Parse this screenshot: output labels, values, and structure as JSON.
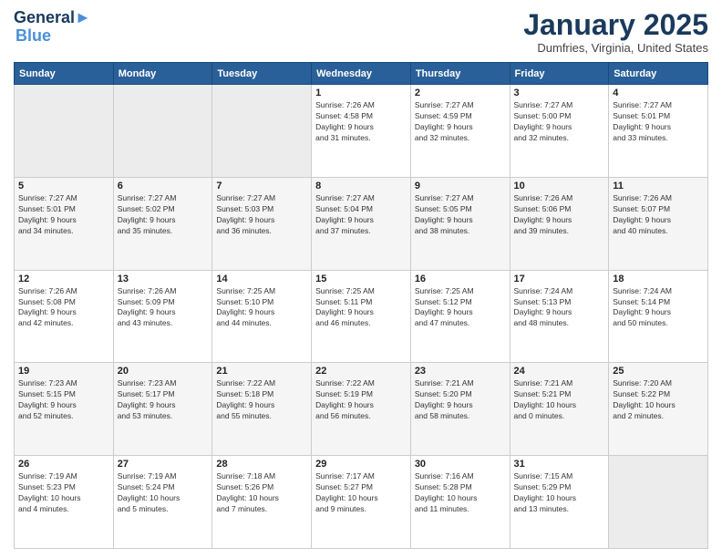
{
  "header": {
    "logo_line1": "General",
    "logo_line2": "Blue",
    "month_title": "January 2025",
    "location": "Dumfries, Virginia, United States"
  },
  "days_of_week": [
    "Sunday",
    "Monday",
    "Tuesday",
    "Wednesday",
    "Thursday",
    "Friday",
    "Saturday"
  ],
  "weeks": [
    [
      {
        "day": "",
        "info": ""
      },
      {
        "day": "",
        "info": ""
      },
      {
        "day": "",
        "info": ""
      },
      {
        "day": "1",
        "info": "Sunrise: 7:26 AM\nSunset: 4:58 PM\nDaylight: 9 hours\nand 31 minutes."
      },
      {
        "day": "2",
        "info": "Sunrise: 7:27 AM\nSunset: 4:59 PM\nDaylight: 9 hours\nand 32 minutes."
      },
      {
        "day": "3",
        "info": "Sunrise: 7:27 AM\nSunset: 5:00 PM\nDaylight: 9 hours\nand 32 minutes."
      },
      {
        "day": "4",
        "info": "Sunrise: 7:27 AM\nSunset: 5:01 PM\nDaylight: 9 hours\nand 33 minutes."
      }
    ],
    [
      {
        "day": "5",
        "info": "Sunrise: 7:27 AM\nSunset: 5:01 PM\nDaylight: 9 hours\nand 34 minutes."
      },
      {
        "day": "6",
        "info": "Sunrise: 7:27 AM\nSunset: 5:02 PM\nDaylight: 9 hours\nand 35 minutes."
      },
      {
        "day": "7",
        "info": "Sunrise: 7:27 AM\nSunset: 5:03 PM\nDaylight: 9 hours\nand 36 minutes."
      },
      {
        "day": "8",
        "info": "Sunrise: 7:27 AM\nSunset: 5:04 PM\nDaylight: 9 hours\nand 37 minutes."
      },
      {
        "day": "9",
        "info": "Sunrise: 7:27 AM\nSunset: 5:05 PM\nDaylight: 9 hours\nand 38 minutes."
      },
      {
        "day": "10",
        "info": "Sunrise: 7:26 AM\nSunset: 5:06 PM\nDaylight: 9 hours\nand 39 minutes."
      },
      {
        "day": "11",
        "info": "Sunrise: 7:26 AM\nSunset: 5:07 PM\nDaylight: 9 hours\nand 40 minutes."
      }
    ],
    [
      {
        "day": "12",
        "info": "Sunrise: 7:26 AM\nSunset: 5:08 PM\nDaylight: 9 hours\nand 42 minutes."
      },
      {
        "day": "13",
        "info": "Sunrise: 7:26 AM\nSunset: 5:09 PM\nDaylight: 9 hours\nand 43 minutes."
      },
      {
        "day": "14",
        "info": "Sunrise: 7:25 AM\nSunset: 5:10 PM\nDaylight: 9 hours\nand 44 minutes."
      },
      {
        "day": "15",
        "info": "Sunrise: 7:25 AM\nSunset: 5:11 PM\nDaylight: 9 hours\nand 46 minutes."
      },
      {
        "day": "16",
        "info": "Sunrise: 7:25 AM\nSunset: 5:12 PM\nDaylight: 9 hours\nand 47 minutes."
      },
      {
        "day": "17",
        "info": "Sunrise: 7:24 AM\nSunset: 5:13 PM\nDaylight: 9 hours\nand 48 minutes."
      },
      {
        "day": "18",
        "info": "Sunrise: 7:24 AM\nSunset: 5:14 PM\nDaylight: 9 hours\nand 50 minutes."
      }
    ],
    [
      {
        "day": "19",
        "info": "Sunrise: 7:23 AM\nSunset: 5:15 PM\nDaylight: 9 hours\nand 52 minutes."
      },
      {
        "day": "20",
        "info": "Sunrise: 7:23 AM\nSunset: 5:17 PM\nDaylight: 9 hours\nand 53 minutes."
      },
      {
        "day": "21",
        "info": "Sunrise: 7:22 AM\nSunset: 5:18 PM\nDaylight: 9 hours\nand 55 minutes."
      },
      {
        "day": "22",
        "info": "Sunrise: 7:22 AM\nSunset: 5:19 PM\nDaylight: 9 hours\nand 56 minutes."
      },
      {
        "day": "23",
        "info": "Sunrise: 7:21 AM\nSunset: 5:20 PM\nDaylight: 9 hours\nand 58 minutes."
      },
      {
        "day": "24",
        "info": "Sunrise: 7:21 AM\nSunset: 5:21 PM\nDaylight: 10 hours\nand 0 minutes."
      },
      {
        "day": "25",
        "info": "Sunrise: 7:20 AM\nSunset: 5:22 PM\nDaylight: 10 hours\nand 2 minutes."
      }
    ],
    [
      {
        "day": "26",
        "info": "Sunrise: 7:19 AM\nSunset: 5:23 PM\nDaylight: 10 hours\nand 4 minutes."
      },
      {
        "day": "27",
        "info": "Sunrise: 7:19 AM\nSunset: 5:24 PM\nDaylight: 10 hours\nand 5 minutes."
      },
      {
        "day": "28",
        "info": "Sunrise: 7:18 AM\nSunset: 5:26 PM\nDaylight: 10 hours\nand 7 minutes."
      },
      {
        "day": "29",
        "info": "Sunrise: 7:17 AM\nSunset: 5:27 PM\nDaylight: 10 hours\nand 9 minutes."
      },
      {
        "day": "30",
        "info": "Sunrise: 7:16 AM\nSunset: 5:28 PM\nDaylight: 10 hours\nand 11 minutes."
      },
      {
        "day": "31",
        "info": "Sunrise: 7:15 AM\nSunset: 5:29 PM\nDaylight: 10 hours\nand 13 minutes."
      },
      {
        "day": "",
        "info": ""
      }
    ]
  ]
}
